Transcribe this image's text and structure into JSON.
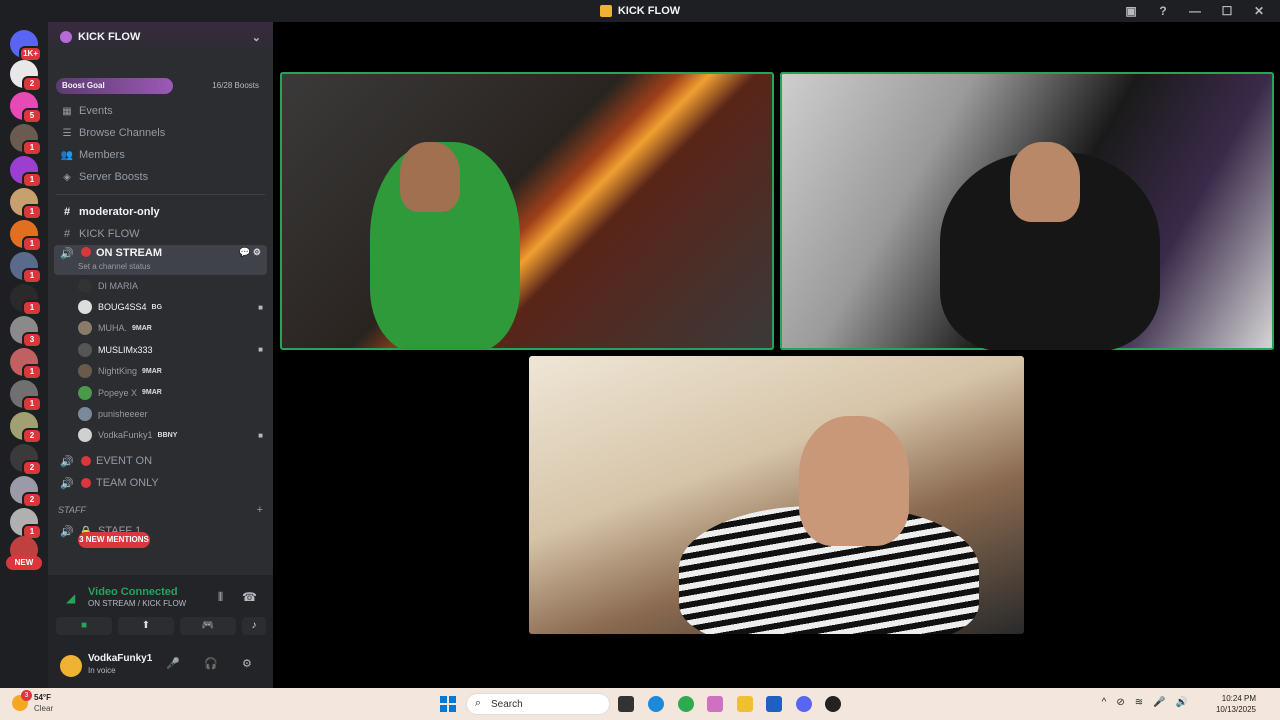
{
  "window": {
    "title": "KICK FLOW"
  },
  "server_rail": {
    "top_badge": "1K+",
    "badges": [
      "2",
      "5",
      "1",
      "1",
      "1",
      "1",
      "1",
      "1",
      "3",
      "1",
      "1",
      "2",
      "2",
      "2",
      "1"
    ],
    "new_label": "NEW"
  },
  "server": {
    "name": "KICK FLOW",
    "boost_goal_label": "Boost Goal",
    "boost_count": "16/28 Boosts",
    "nav": [
      "Events",
      "Browse Channels",
      "Members",
      "Server Boosts"
    ]
  },
  "channels": {
    "moderator": "moderator-only",
    "kickflow": "KICK FLOW",
    "on_stream": "ON STREAM",
    "on_stream_status": "Set a channel status",
    "event_on": "EVENT ON",
    "team_only": "TEAM ONLY",
    "staff_category": "STAFF",
    "staff_channel": "STAFF 1",
    "mentions_pill": "3 NEW MENTIONS"
  },
  "voice_users": [
    {
      "name": "DI MARIA",
      "tag": ""
    },
    {
      "name": "BOUG4SS4",
      "tag": "BG"
    },
    {
      "name": "MUHA.",
      "tag": "9MAR"
    },
    {
      "name": "MUSLIMx333",
      "tag": ""
    },
    {
      "name": "NightKing",
      "tag": "9MAR"
    },
    {
      "name": "Popeye X",
      "tag": "9MAR"
    },
    {
      "name": "punisheeeer",
      "tag": ""
    },
    {
      "name": "VodkaFunky1",
      "tag": "BBNY"
    }
  ],
  "voice_panel": {
    "status": "Video Connected",
    "location": "ON STREAM / KICK FLOW",
    "username": "VodkaFunky1",
    "user_status": "In voice"
  },
  "taskbar": {
    "temperature": "54°F",
    "condition": "Clear",
    "weather_badge": "3",
    "search_placeholder": "Search",
    "time": "10:24 PM",
    "date": "10/13/2025"
  },
  "colors": {
    "accent_green": "#23a55a",
    "mention_red": "#da373c",
    "blurple": "#5865f2"
  }
}
